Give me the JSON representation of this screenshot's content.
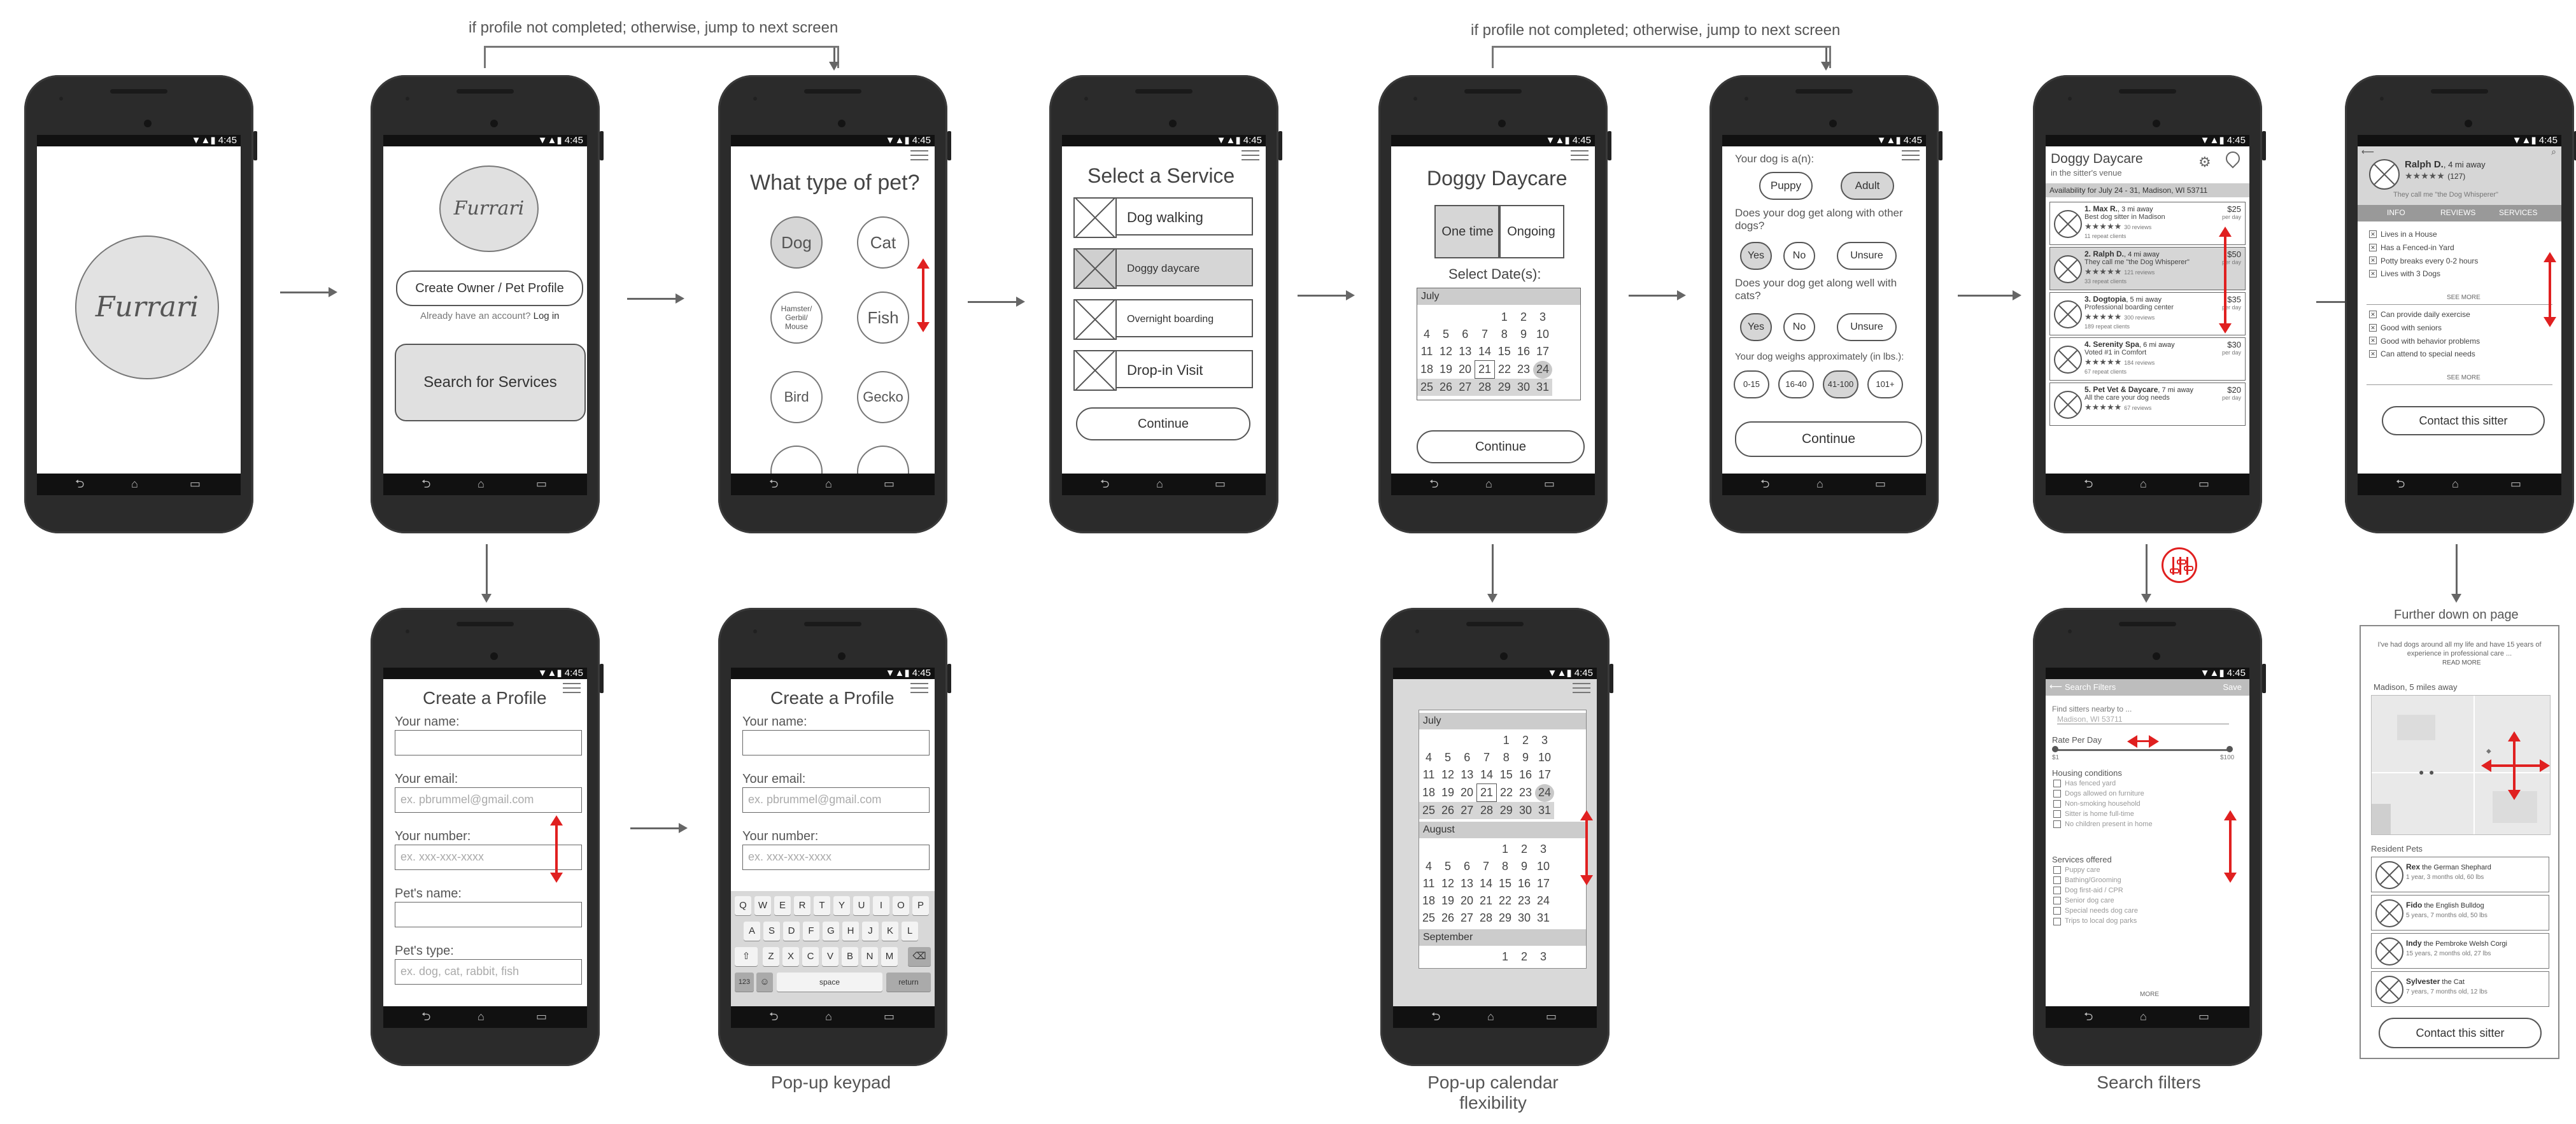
{
  "annotations": {
    "profile_note": "if profile not completed;  otherwise, jump to next screen",
    "further_down": "Further down on page",
    "caption_keypad": "Pop-up keypad",
    "caption_calendar_1": "Pop-up calendar",
    "caption_calendar_2": "flexibility",
    "caption_filters": "Search filters"
  },
  "status_time": "4:45",
  "status_icons": "▼▲▮",
  "nav": {
    "back": "⮌",
    "home": "⌂",
    "recent": "▭"
  },
  "splash": {
    "logo": "Furrari"
  },
  "home": {
    "logo": "Furrari",
    "create_btn": "Create Owner / Pet Profile",
    "already": "Already have an account?",
    "login": "Log in",
    "search_btn": "Search for Services"
  },
  "pet_type": {
    "title": "What type of pet?",
    "pets": [
      "Dog",
      "Cat",
      "Hamster/ Gerbil/ Mouse",
      "Fish",
      "Bird",
      "Gecko"
    ]
  },
  "service": {
    "title": "Select a Service",
    "options": [
      "Dog walking",
      "Doggy daycare",
      "Overnight boarding",
      "Drop-in Visit"
    ],
    "continue": "Continue"
  },
  "daycare": {
    "title": "Doggy Daycare",
    "one_time": "One time",
    "ongoing": "Ongoing",
    "select_dates": "Select Date(s):",
    "month": "July",
    "continue": "Continue"
  },
  "calendar": {
    "july": {
      "name": "July",
      "weeks": [
        [
          "",
          "",
          "",
          "",
          "",
          "1",
          "2",
          "3"
        ],
        [
          "",
          "4",
          "5",
          "6",
          "7",
          "8",
          "9",
          "10"
        ],
        [
          "",
          "11",
          "12",
          "13",
          "14",
          "15",
          "16",
          "17"
        ],
        [
          "",
          "18",
          "19",
          "20",
          "21",
          "22",
          "23",
          "24"
        ],
        [
          "",
          "25",
          "26",
          "27",
          "28",
          "29",
          "30",
          "31"
        ]
      ]
    },
    "august": {
      "name": "August",
      "weeks": [
        [
          "",
          "",
          "",
          "",
          "",
          "1",
          "2",
          "3"
        ],
        [
          "",
          "4",
          "5",
          "6",
          "7",
          "8",
          "9",
          "10"
        ],
        [
          "",
          "11",
          "12",
          "13",
          "14",
          "15",
          "16",
          "17"
        ],
        [
          "",
          "18",
          "19",
          "20",
          "21",
          "22",
          "23",
          "24"
        ],
        [
          "",
          "25",
          "26",
          "27",
          "28",
          "29",
          "30",
          "31"
        ]
      ]
    },
    "september": {
      "name": "September",
      "weeks": [
        [
          "",
          "",
          "",
          "",
          "",
          "1",
          "2",
          "3"
        ]
      ]
    }
  },
  "dog_q": {
    "q1": "Your dog is a(n):",
    "puppy": "Puppy",
    "adult": "Adult",
    "q2": "Does your dog get along with other dogs?",
    "q3": "Does your dog get along well with cats?",
    "yes": "Yes",
    "no": "No",
    "unsure": "Unsure",
    "q4": "Your dog weighs approximately (in lbs.):",
    "weights": [
      "0-15",
      "16-40",
      "41-100",
      "101+"
    ],
    "continue": "Continue"
  },
  "results": {
    "title": "Doggy Daycare",
    "subtitle": "in the sitter's venue",
    "availability": "Availability for July 24 - 31, Madison, WI 53711",
    "items": [
      {
        "name": "1. Max R.",
        "dist": ", 3 mi away",
        "desc": "Best dog sitter in Madison",
        "reviews": "30 reviews",
        "repeat": "11 repeat clients",
        "price": "$25"
      },
      {
        "name": "2. Ralph D.",
        "dist": ", 4 mi away",
        "desc": "They call me \"the Dog Whisperer\"",
        "reviews": "121 reviews",
        "repeat": "33 repeat clients",
        "price": "$50"
      },
      {
        "name": "3. Dogtopia",
        "dist": ", 5 mi away",
        "desc": "Professional boarding center",
        "reviews": "300 reviews",
        "repeat": "189 repeat clients",
        "price": "$35"
      },
      {
        "name": "4. Serenity Spa",
        "dist": ", 6 mi away",
        "desc": "Voted #1 in Comfort",
        "reviews": "184 reviews",
        "repeat": "67 repeat clients",
        "price": "$30"
      },
      {
        "name": "5. Pet Vet & Daycare",
        "dist": ", 7 mi away",
        "desc": "All the care your dog needs",
        "reviews": "67 reviews",
        "repeat": "",
        "price": "$20"
      }
    ],
    "per_day": "per day"
  },
  "sitter": {
    "name": "Ralph D.",
    "dist": ", 4 mi away",
    "reviews": "(127)",
    "tagline": "They call me \"the Dog Whisperer\"",
    "tabs": [
      "INFO",
      "REVIEWS",
      "SERVICES"
    ],
    "list1": [
      "Lives in a House",
      "Has a Fenced-in Yard",
      "Potty breaks every 0-2 hours",
      "Lives with 3 Dogs"
    ],
    "see_more": "SEE MORE",
    "list2": [
      "Can provide daily exercise",
      "Good with seniors",
      "Good with behavior problems",
      "Can attend to special needs"
    ],
    "contact": "Contact this sitter"
  },
  "profile": {
    "title": "Create a Profile",
    "fields": [
      {
        "label": "Your name:",
        "placeholder": ""
      },
      {
        "label": "Your email:",
        "placeholder": "ex. pbrummel@gmail.com"
      },
      {
        "label": "Your number:",
        "placeholder": "ex. xxx-xxx-xxxx"
      },
      {
        "label": "Pet's name:",
        "placeholder": ""
      },
      {
        "label": "Pet's type:",
        "placeholder": "ex. dog, cat, rabbit, fish"
      }
    ]
  },
  "keyboard": {
    "row1": [
      "Q",
      "W",
      "E",
      "R",
      "T",
      "Y",
      "U",
      "I",
      "O",
      "P"
    ],
    "row2": [
      "A",
      "S",
      "D",
      "F",
      "G",
      "H",
      "J",
      "K",
      "L"
    ],
    "row3": [
      "Z",
      "X",
      "C",
      "V",
      "B",
      "N",
      "M"
    ],
    "num": "123",
    "space": "space",
    "ret": "return"
  },
  "filters": {
    "title": "Search Filters",
    "save": "Save",
    "find_near": "Find sitters nearby to ...",
    "location": "Madison, WI 53711",
    "rate": "Rate Per Day",
    "min": "$1",
    "max": "$100",
    "housing": "Housing conditions",
    "housing_opts": [
      "Has fenced yard",
      "Dogs allowed on furniture",
      "Non-smoking household",
      "Sitter is home full-time",
      "No children present in home"
    ],
    "services": "Services offered",
    "service_opts": [
      "Puppy care",
      "Bathing/Grooming",
      "Dog first-aid / CPR",
      "Senior dog care",
      "Special needs dog care",
      "Trips to local dog parks"
    ],
    "more": "MORE"
  },
  "further": {
    "bio": "I've had dogs around all my life and have 15 years of experience in professional care ...",
    "read_more": "READ MORE",
    "location": "Madison, 5 miles away",
    "resident": "Resident Pets",
    "pets": [
      {
        "name": "Rex",
        "breed": " the German Shephard",
        "info": "1 year, 3 months old, 60 lbs"
      },
      {
        "name": "Fido",
        "breed": " the English Bulldog",
        "info": "5 years, 7 months old, 50 lbs"
      },
      {
        "name": "Indy",
        "breed": " the Pembroke Welsh Corgi",
        "info": "15 years, 2 months old, 27 lbs"
      },
      {
        "name": "Sylvester",
        "breed": " the Cat",
        "info": "7 years, 7 months old, 12 lbs"
      }
    ],
    "contact": "Contact this sitter"
  }
}
